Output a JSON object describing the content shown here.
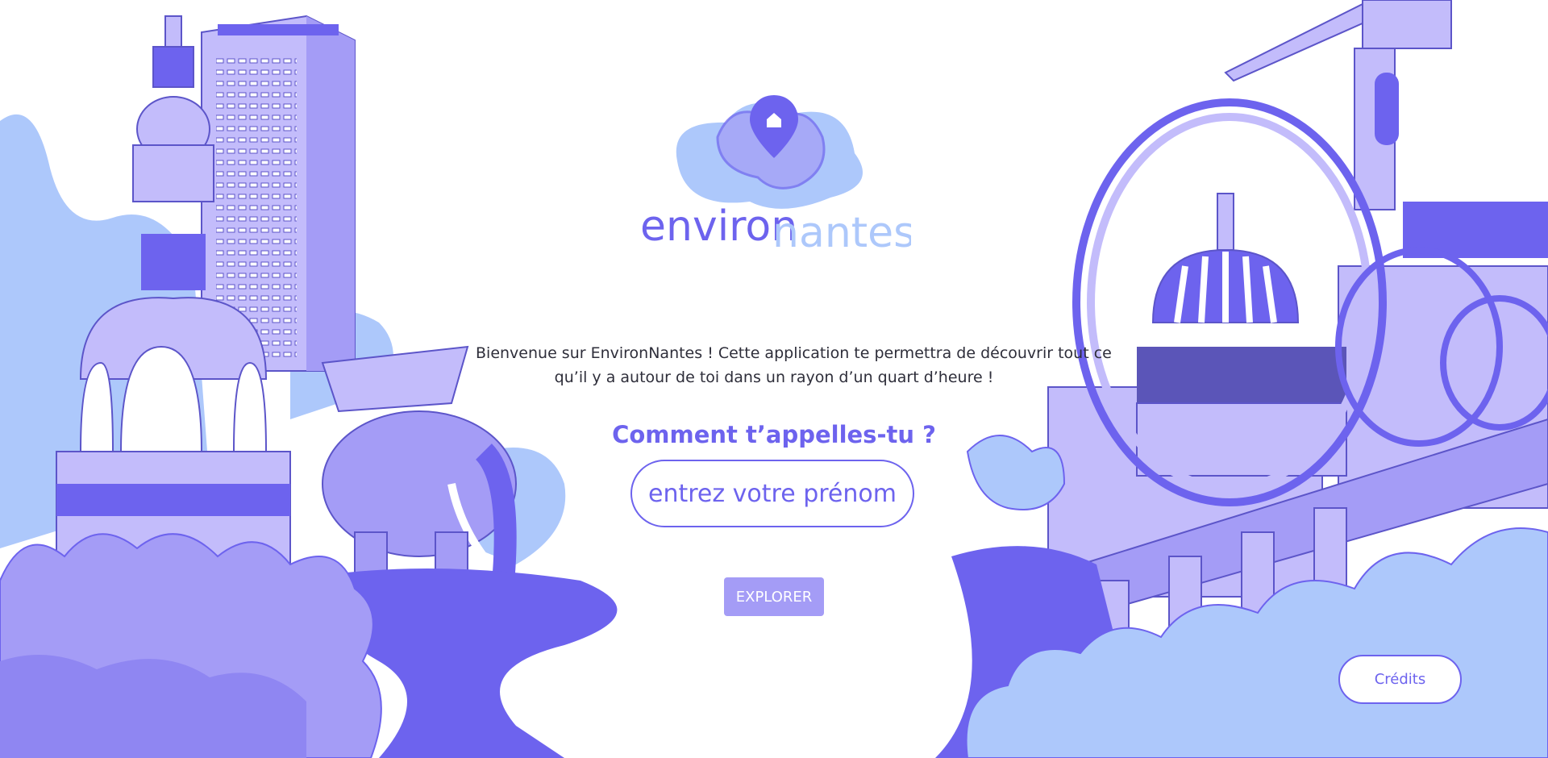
{
  "brand": {
    "part1": "environ",
    "part2": "nantes"
  },
  "intro": {
    "line1": "Bienvenue sur EnvironNantes ! Cette application te permettra de découvrir tout ce",
    "line2": "qu’il y a autour de toi dans un rayon d’un quart d’heure !"
  },
  "question": "Comment t’appelles-tu ?",
  "name_input": {
    "placeholder": "entrez votre prénom",
    "value": ""
  },
  "explore_label": "EXPLORER",
  "credits_label": "Crédits",
  "colors": {
    "accent": "#6d63ee",
    "light": "#c3bcfb",
    "sky": "#adc8fb",
    "button": "#a49cf6"
  },
  "icons": [
    "location-pin-icon",
    "house-icon"
  ]
}
